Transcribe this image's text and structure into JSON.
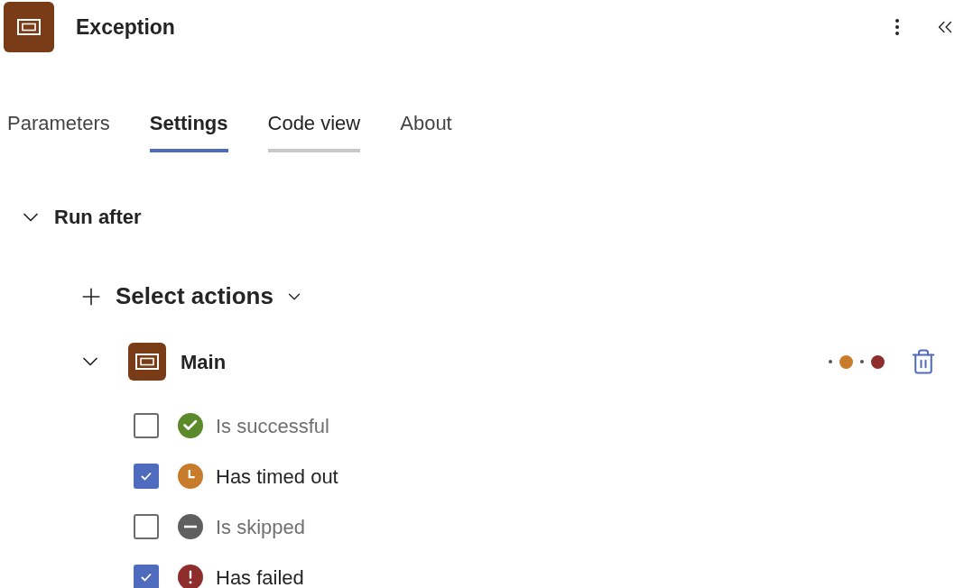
{
  "header": {
    "title": "Exception"
  },
  "tabs": [
    {
      "label": "Parameters",
      "selected": false,
      "hovered": false
    },
    {
      "label": "Settings",
      "selected": true,
      "hovered": false
    },
    {
      "label": "Code view",
      "selected": false,
      "hovered": true
    },
    {
      "label": "About",
      "selected": false,
      "hovered": false
    }
  ],
  "section": {
    "title": "Run after",
    "expanded": true
  },
  "select_actions": {
    "label": "Select actions"
  },
  "action": {
    "name": "Main",
    "expanded": true,
    "conditions": [
      {
        "kind": "success",
        "label": "Is successful",
        "checked": false,
        "color": "#5b8a2a"
      },
      {
        "kind": "timeout",
        "label": "Has timed out",
        "checked": true,
        "color": "#c87b2a"
      },
      {
        "kind": "skipped",
        "label": "Is skipped",
        "checked": false,
        "color": "#5f5f5f"
      },
      {
        "kind": "failed",
        "label": "Has failed",
        "checked": true,
        "color": "#8f2d2d"
      }
    ]
  }
}
